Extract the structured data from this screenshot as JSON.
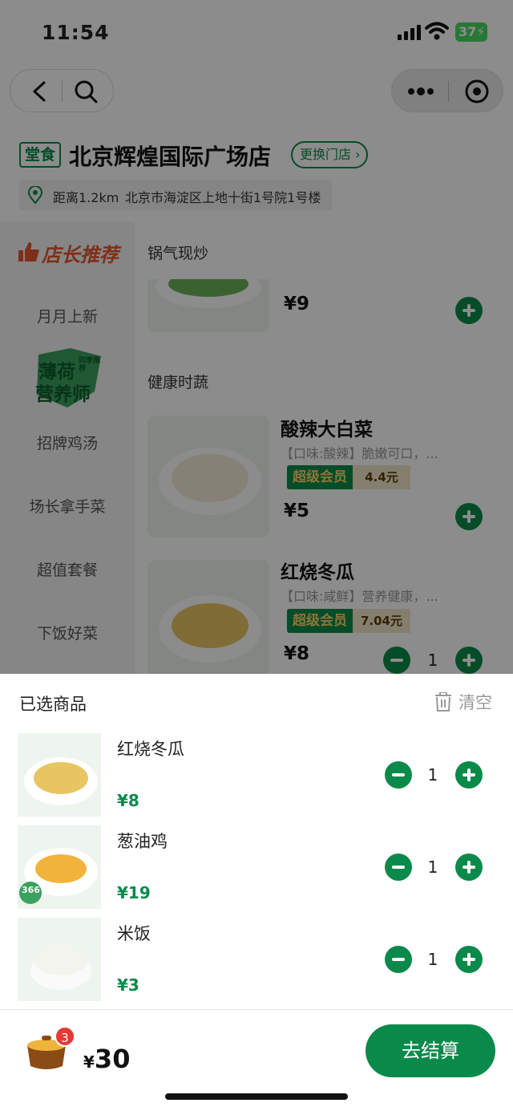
{
  "status_bar": {
    "time": "11:54",
    "battery": "37"
  },
  "store": {
    "tag": "堂食",
    "name": "北京辉煌国际广场店",
    "change_label": "更换门店",
    "distance": "距离1.2km",
    "address": "北京市海淀区上地十街1号院1号楼"
  },
  "categories": {
    "featured": "店长推荐",
    "items": [
      "月月上新",
      "招牌鸡汤",
      "场长拿手菜",
      "超值套餐",
      "下饭好菜"
    ],
    "badge_line1": "薄荷",
    "badge_line2": "营养师",
    "badge_small": "四季推荐"
  },
  "menu": {
    "sections": [
      "锅气现炒",
      "健康时蔬"
    ],
    "partial_price": "¥9",
    "dishes": [
      {
        "name": "酸辣大白菜",
        "desc": "【口味:酸辣】脆嫩可口，...",
        "member_label": "超级会员",
        "member_price": "4.4元",
        "price": "¥5"
      },
      {
        "name": "红烧冬瓜",
        "desc": "【口味:咸鲜】营养健康，...",
        "member_label": "超级会员",
        "member_price": "7.04元",
        "price": "¥8",
        "qty": "1"
      }
    ]
  },
  "cart": {
    "title": "已选商品",
    "clear_label": "清空",
    "items": [
      {
        "name": "红烧冬瓜",
        "price": "¥8",
        "qty": "1"
      },
      {
        "name": "葱油鸡",
        "price": "¥19",
        "qty": "1",
        "tag": "366"
      },
      {
        "name": "米饭",
        "price": "¥3",
        "qty": "1"
      }
    ]
  },
  "bottom": {
    "count": "3",
    "currency": "¥",
    "total": "30",
    "checkout_label": "去结算"
  },
  "colors": {
    "accent": "#0a8a4a",
    "badge": "#e53935",
    "featured": "#e4572e"
  }
}
